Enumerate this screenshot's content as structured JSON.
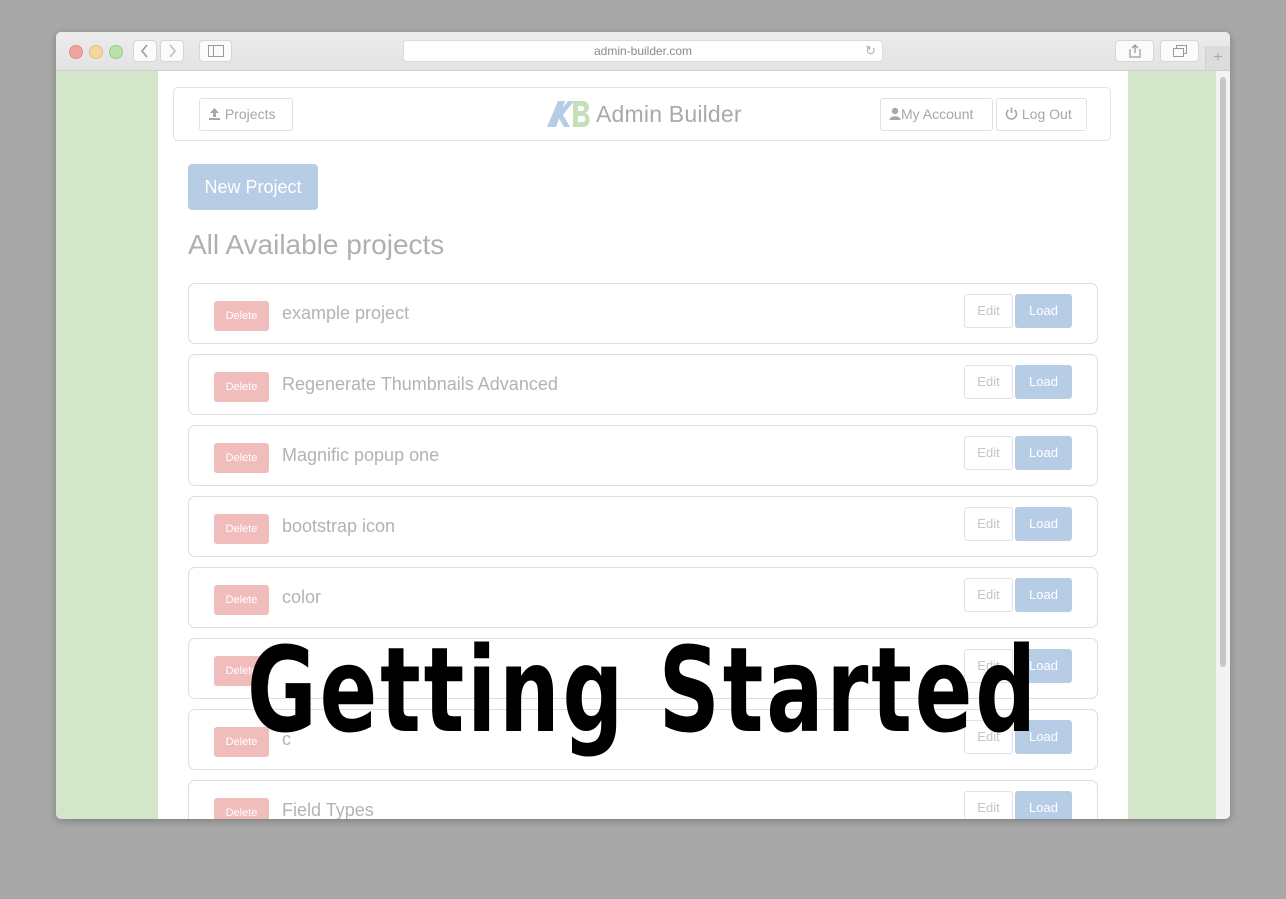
{
  "browser": {
    "url": "admin-builder.com",
    "back_icon": "chevron-left-icon",
    "forward_icon": "chevron-right-icon",
    "sidebar_icon": "sidebar-icon",
    "reload_icon": "reload-icon",
    "share_icon": "share-icon",
    "tabs_icon": "tabs-icon",
    "plus_label": "+"
  },
  "header": {
    "projects_label": "Projects",
    "brand": "Admin Builder",
    "account_label": "My Account",
    "logout_label": "Log Out"
  },
  "main": {
    "new_project_label": "New Project",
    "heading": "All Available projects",
    "delete_label": "Delete",
    "edit_label": "Edit",
    "load_label": "Load",
    "projects": [
      "example project",
      "Regenerate Thumbnails Advanced",
      "Magnific popup one",
      "bootstrap icon",
      "color",
      "",
      "c",
      "Field Types"
    ]
  },
  "overlay": {
    "text": "Getting Started"
  },
  "colors": {
    "accent": "#b7cde6",
    "danger": "#f1bcbc",
    "side_background": "#d3e6ca"
  }
}
